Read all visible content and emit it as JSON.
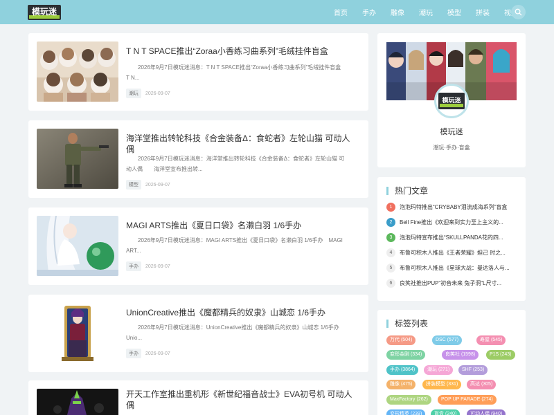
{
  "colors": {
    "header": "#8fd1dd",
    "accent": "#8fd1dd",
    "background": "#f0f3f5"
  },
  "site": {
    "logo_text": "模玩迷"
  },
  "nav": {
    "items": [
      "首页",
      "手办",
      "雕像",
      "潮玩",
      "模型",
      "拼装",
      "视频"
    ],
    "search_icon": "search-icon"
  },
  "articles": [
    {
      "title": "T N T SPACE推出“Zoraa小香练习曲系列”毛绒挂件盲盒",
      "excerpt": "2026年9月7日模玩迷消息：T N T SPACE推出“Zoraa小香练习曲系列”毛绒挂件盲盒　　T N...",
      "tag": "潮玩",
      "date": "2026-09-07"
    },
    {
      "title": "海洋堂推出转轮科技《合金装备Δ：食蛇者》左轮山猫 可动人偶",
      "excerpt": "2026年9月7日模玩迷消息：海洋堂推出转轮科技《合金装备Δ：食蛇者》左轮山猫 可动人偶　　海洋堂宣布推出转...",
      "tag": "模型",
      "date": "2026-09-07"
    },
    {
      "title": "MAGI ARTS推出《夏日口袋》名濑白羽 1/6手办",
      "excerpt": "2026年9月7日模玩迷消息：MAGI ARTS推出《夏日口袋》名濑白羽 1/6手办　MAGI ART...",
      "tag": "手办",
      "date": "2026-09-07"
    },
    {
      "title": "UnionCreative推出《魔都精兵的奴隶》山城恋 1/6手办",
      "excerpt": "2026年9月7日模玩迷消息：UnionCreative推出《魔都精兵的奴隶》山城恋 1/6手办　　Unio...",
      "tag": "手办",
      "date": "2026-09-07"
    },
    {
      "title": "开天工作室推出重机形《新世纪福音战士》EVA初号机 可动人偶",
      "excerpt": "",
      "tag": "",
      "date": ""
    }
  ],
  "profile": {
    "name": "模玩迷",
    "description": "潮玩·手办·盲盒"
  },
  "hot": {
    "title": "热门文章",
    "items": [
      {
        "rank": "1",
        "text": "泡泡玛特推出“CRYBABY泪流成海系列”盲盒",
        "color": "#f0705f"
      },
      {
        "rank": "2",
        "text": "Bell Fine推出《欢迎来到实力至上主义的...",
        "color": "#3a9dc9"
      },
      {
        "rank": "3",
        "text": "泡泡玛特宣布推出“SKULLPANDA花的四...",
        "color": "#5cb85c"
      },
      {
        "rank": "4",
        "text": "布鲁可积木人推出《王者荣耀》妲己 时之...",
        "color": ""
      },
      {
        "rank": "5",
        "text": "布鲁可积木人推出《星球大战：曼达洛人与...",
        "color": ""
      },
      {
        "rank": "6",
        "text": "良笑社推出PUP“初音未来 兔子洞”L尺寸...",
        "color": ""
      }
    ]
  },
  "tags_widget": {
    "title": "标签列表",
    "tags": [
      {
        "label": "万代 (504)",
        "color": "#f59a86"
      },
      {
        "label": "DSC (577)",
        "color": "#7fcbe8"
      },
      {
        "label": "寿屋 (545)",
        "color": "#f48fb1"
      },
      {
        "label": "变形金刚 (334)",
        "color": "#7ed3a3"
      },
      {
        "label": "良笑社 (1598)",
        "color": "#c792ea"
      },
      {
        "label": "P1S (243)",
        "color": "#9ccc65"
      },
      {
        "label": "手办 (3864)",
        "color": "#4fc3c8"
      },
      {
        "label": "潮玩 (271)",
        "color": "#f5a7d6"
      },
      {
        "label": "SHF (253)",
        "color": "#b39ddb"
      },
      {
        "label": "雕像 (475)",
        "color": "#f4b26a"
      },
      {
        "label": "拼装模型 (331)",
        "color": "#ffb74d"
      },
      {
        "label": "高达 (305)",
        "color": "#f48fb1"
      },
      {
        "label": "MaxFactory (262)",
        "color": "#aed581"
      },
      {
        "label": "POP UP PARADE (274)",
        "color": "#ff9e58"
      },
      {
        "label": "变形精英 (239)",
        "color": "#64b5f6"
      },
      {
        "label": "盲盒 (240)",
        "color": "#4dd0a8"
      },
      {
        "label": "可动人偶 (940)",
        "color": "#9575cd"
      }
    ]
  }
}
